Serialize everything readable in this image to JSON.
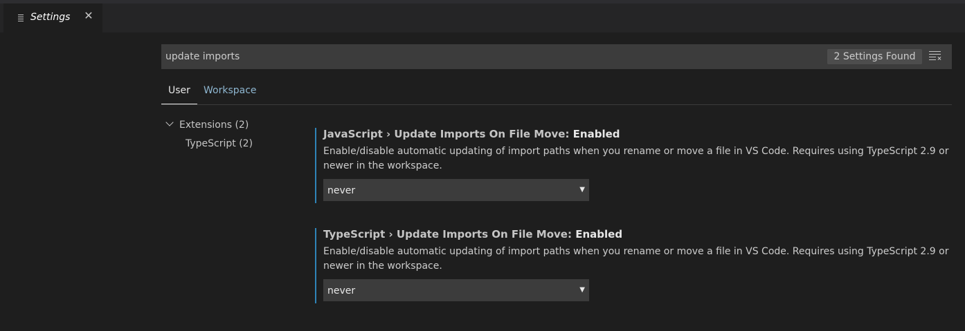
{
  "editor_tab": {
    "label": "Settings",
    "icon": "settings-list-icon",
    "close_icon": "close-icon"
  },
  "search": {
    "value": "update imports",
    "results_badge": "2 Settings Found",
    "clear_icon": "clear-filter-icon"
  },
  "scope_tabs": [
    {
      "label": "User",
      "active": true
    },
    {
      "label": "Workspace",
      "active": false
    }
  ],
  "toc": {
    "group": "Extensions (2)",
    "child": "TypeScript (2)"
  },
  "settings": [
    {
      "category": "JavaScript › Update Imports On File Move: ",
      "name": "Enabled",
      "description": "Enable/disable automatic updating of import paths when you rename or move a file in VS Code. Requires using TypeScript 2.9 or newer in the workspace.",
      "value": "never"
    },
    {
      "category": "TypeScript › Update Imports On File Move: ",
      "name": "Enabled",
      "description": "Enable/disable automatic updating of import paths when you rename or move a file in VS Code. Requires using TypeScript 2.9 or newer in the workspace.",
      "value": "never"
    }
  ],
  "colors": {
    "background": "#1e1e1e",
    "accent_border": "#2f84b8",
    "input_background": "#3c3c3c"
  }
}
